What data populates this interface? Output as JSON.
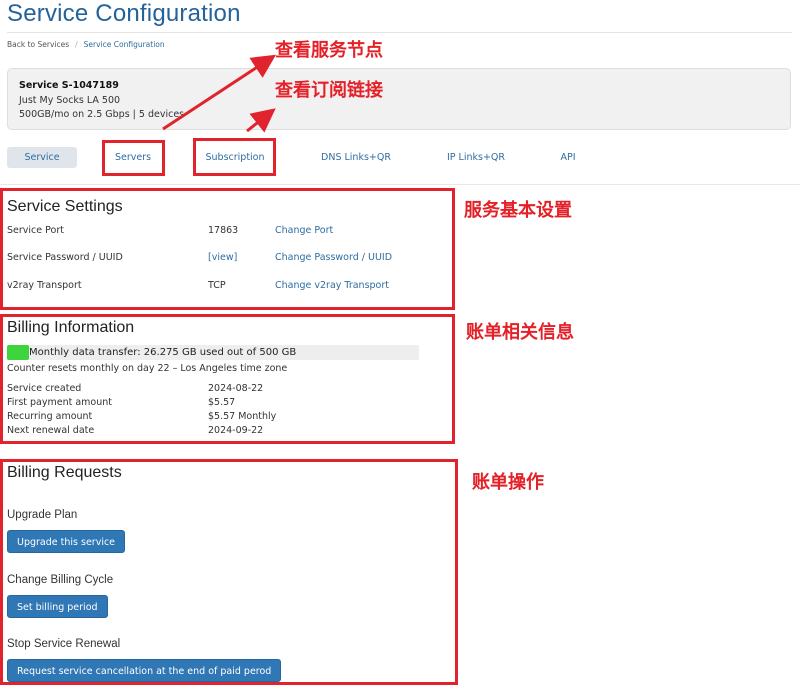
{
  "page": {
    "title": "Service Configuration"
  },
  "breadcrumb": {
    "back": "Back to Services",
    "separator": "/",
    "current": "Service Configuration"
  },
  "service": {
    "title": "Service S-1047189",
    "plan": "Just My Socks LA 500",
    "specs": "500GB/mo on 2.5 Gbps | 5 devices"
  },
  "tabs": [
    {
      "label": "Service",
      "active": true
    },
    {
      "label": "Servers"
    },
    {
      "label": "Subscription"
    },
    {
      "label": "DNS Links+QR"
    },
    {
      "label": "IP Links+QR"
    },
    {
      "label": "API"
    }
  ],
  "settings": {
    "title": "Service Settings",
    "rows": [
      {
        "label": "Service Port",
        "value": "17863",
        "action": "Change Port"
      },
      {
        "label": "Service Password / UUID",
        "value": "[view]",
        "action": "Change Password / UUID"
      },
      {
        "label": "v2ray Transport",
        "value": "TCP",
        "action": "Change v2ray Transport"
      }
    ]
  },
  "billing": {
    "title": "Billing Information",
    "usage_text": "Monthly data transfer: 26.275 GB used out of 500 GB",
    "usage_fraction": 0.0526,
    "reset_note": "Counter resets monthly on day 22 – Los Angeles time zone",
    "rows": [
      {
        "label": "Service created",
        "value": "2024-08-22"
      },
      {
        "label": "First payment amount",
        "value": "$5.57"
      },
      {
        "label": "Recurring amount",
        "value": "$5.57 Monthly"
      },
      {
        "label": "Next renewal date",
        "value": "2024-09-22"
      }
    ]
  },
  "requests": {
    "title": "Billing Requests",
    "upgrade_heading": "Upgrade Plan",
    "upgrade_button": "Upgrade this service",
    "cycle_heading": "Change Billing Cycle",
    "cycle_button": "Set billing period",
    "stop_heading": "Stop Service Renewal",
    "stop_button": "Request service cancellation at the end of paid perod"
  },
  "annotations": {
    "servers": "查看服务节点",
    "subscription": "查看订阅链接",
    "settings": "服务基本设置",
    "billing": "账单相关信息",
    "requests": "账单操作"
  },
  "colors": {
    "accent": "#2f77b5",
    "title": "#24639a",
    "annotation_red": "#e0232c",
    "usage_green": "#3ed43e"
  }
}
